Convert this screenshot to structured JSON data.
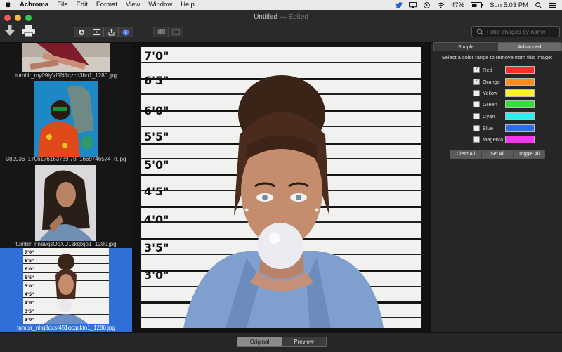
{
  "menubar": {
    "apple": "",
    "items": [
      "Achroma",
      "File",
      "Edit",
      "Format",
      "View",
      "Window",
      "Help"
    ],
    "battery": "47%",
    "clock": "Sun 5:03 PM"
  },
  "window": {
    "title": "Untitled",
    "edited": "— Edited"
  },
  "toolbar": {
    "search_placeholder": "Filter images by name"
  },
  "thumbnails": [
    {
      "name": "tumblr_my09iyVf9N1qzcd3bo1_1280.jpg",
      "selected": false
    },
    {
      "name": "380936_1706176163789 78_1669746574_n.jpg",
      "selected": false
    },
    {
      "name": "tumblr_nne9qsOoXU1skqlxjo1_1280.jpg",
      "selected": false
    },
    {
      "name": "tumblr_nhq8dxsf451qcqckto1_1280.jpg",
      "selected": true
    }
  ],
  "height_chart": [
    "7'0\"",
    "6'5\"",
    "6'0\"",
    "5'5\"",
    "5'0\"",
    "4'5\"",
    "4'0\"",
    "3'5\"",
    "3'0\""
  ],
  "panel": {
    "tabs": [
      "Simple",
      "Advanced"
    ],
    "active_tab": "Advanced",
    "instruction": "Select a color range to remove from this image:",
    "colors": [
      {
        "name": "Red",
        "checked": true,
        "hex": "#ff2a2a"
      },
      {
        "name": "Orange",
        "checked": true,
        "hex": "#ff8c1a"
      },
      {
        "name": "Yellow",
        "checked": false,
        "hex": "#fff22a"
      },
      {
        "name": "Green",
        "checked": false,
        "hex": "#2ee03a"
      },
      {
        "name": "Cyan",
        "checked": false,
        "hex": "#2af0f0"
      },
      {
        "name": "Blue",
        "checked": false,
        "hex": "#2a6ff0"
      },
      {
        "name": "Magenta",
        "checked": false,
        "hex": "#f03af0"
      }
    ],
    "buttons": [
      "Clear  All",
      "Set All",
      "Toggle All"
    ]
  },
  "bottom": {
    "tabs": [
      "Original",
      "Preview"
    ],
    "active_tab": "Original"
  }
}
